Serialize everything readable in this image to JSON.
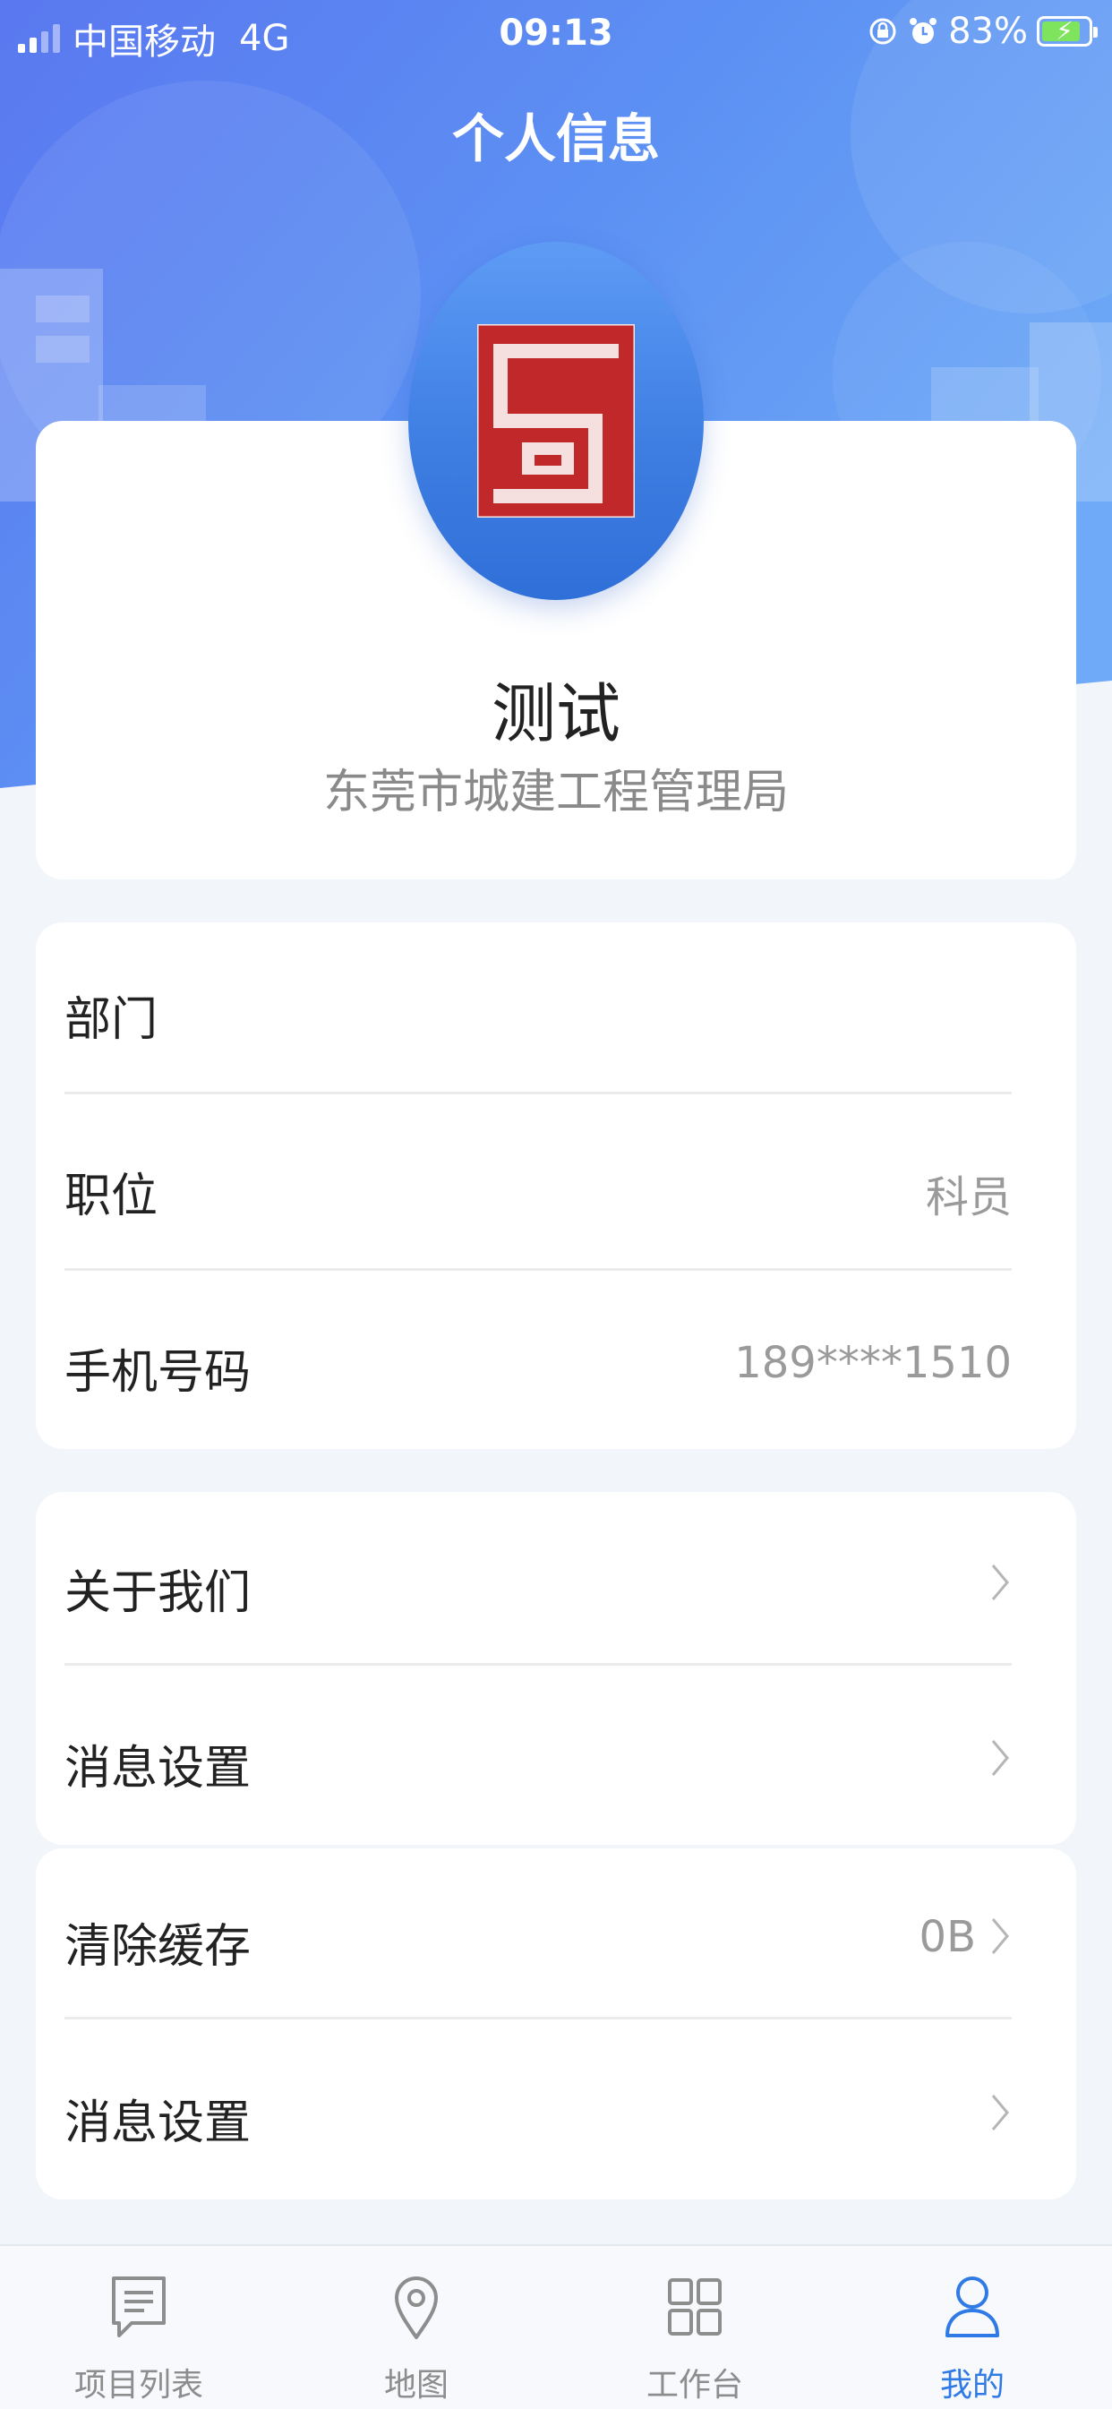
{
  "status_bar": {
    "carrier": "中国移动",
    "network": "4G",
    "time": "09:13",
    "battery": "83%",
    "battery_level": 0.83
  },
  "header": {
    "title": "个人信息"
  },
  "profile": {
    "name": "测试",
    "organization": "东莞市城建工程管理局"
  },
  "info_rows": [
    {
      "label": "部门",
      "value": ""
    },
    {
      "label": "职位",
      "value": "科员"
    },
    {
      "label": "手机号码",
      "value": "189****1510"
    }
  ],
  "menu_rows": [
    {
      "label": "关于我们",
      "value": ""
    },
    {
      "label": "消息设置",
      "value": ""
    },
    {
      "label": "清除缓存",
      "value": "0B"
    },
    {
      "label": "消息设置",
      "value": ""
    }
  ],
  "tabbar": [
    {
      "label": "项目列表",
      "icon": "message-list-icon"
    },
    {
      "label": "地图",
      "icon": "map-pin-icon"
    },
    {
      "label": "工作台",
      "icon": "grid-icon"
    },
    {
      "label": "我的",
      "icon": "person-icon",
      "active": true
    }
  ],
  "colors": {
    "accent": "#2f7ae5",
    "header_start": "#4f7bf2",
    "header_end": "#6aa7f7",
    "logo_red": "#c0282a"
  }
}
